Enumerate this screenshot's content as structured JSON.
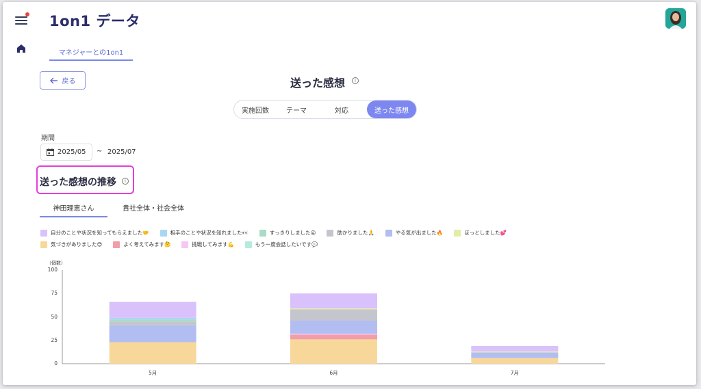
{
  "header": {
    "title": "1on1 データ",
    "tab": "マネジャーとの1on1"
  },
  "nav": {
    "back_label": "戻る",
    "page_title": "送った感想",
    "info_glyph": "i"
  },
  "segments": [
    {
      "label": "実施回数",
      "active": false
    },
    {
      "label": "テーマ",
      "active": false
    },
    {
      "label": "対応",
      "active": false
    },
    {
      "label": "送った感想",
      "active": true
    }
  ],
  "period": {
    "label": "期間",
    "start": "2025/05",
    "tilde": "~",
    "end": "2025/07"
  },
  "section": {
    "title": "送った感想の推移",
    "tabs": [
      {
        "label": "神田理恵さん",
        "active": true
      },
      {
        "label": "貴社全体・社会全体",
        "active": false
      }
    ]
  },
  "legend": [
    {
      "label": "自分のことや状況を知ってもらえました🤝",
      "color": "#d9c2fb"
    },
    {
      "label": "相手のことや状況を知れました👀",
      "color": "#aad6f0"
    },
    {
      "label": "すっきりしました😜",
      "color": "#a8dcc7"
    },
    {
      "label": "助かりました🙏",
      "color": "#c5c6cd"
    },
    {
      "label": "やる気が出ました🔥",
      "color": "#b2bdf1"
    },
    {
      "label": "ほっとしました💕",
      "color": "#e2eda5"
    },
    {
      "label": "気づきがありました😍",
      "color": "#f8d89a"
    },
    {
      "label": "よく考えてみます🤔",
      "color": "#f29ea8"
    },
    {
      "label": "挑戦してみます💪",
      "color": "#f7c6f5"
    },
    {
      "label": "もう一度会話したいです💬",
      "color": "#b5ebdd"
    }
  ],
  "chart_data": {
    "type": "bar",
    "stacked": true,
    "ylabel": "（個数）",
    "ylim": [
      0,
      100
    ],
    "yticks": [
      0,
      25,
      50,
      75,
      100
    ],
    "categories": [
      "5月",
      "6月",
      "7月"
    ],
    "series": [
      {
        "name": "気づきがありました😍",
        "color": "#f8d89a",
        "values": [
          23,
          26,
          6
        ]
      },
      {
        "name": "よく考えてみます🤔",
        "color": "#f29ea8",
        "values": [
          0,
          5,
          0
        ]
      },
      {
        "name": "挑戦してみます💪",
        "color": "#f7c6f5",
        "values": [
          0,
          1,
          0
        ]
      },
      {
        "name": "やる気が出ました🔥",
        "color": "#b2bdf1",
        "values": [
          18,
          14,
          6
        ]
      },
      {
        "name": "助かりました🙏",
        "color": "#c5c6cd",
        "values": [
          4,
          12,
          0
        ]
      },
      {
        "name": "すっきりしました😜",
        "color": "#a8dcc7",
        "values": [
          2,
          0,
          0
        ]
      },
      {
        "name": "ほっとしました💕",
        "color": "#e2eda5",
        "values": [
          0,
          1,
          1
        ]
      },
      {
        "name": "相手のことや状況を知れました👀",
        "color": "#aad6f0",
        "values": [
          2,
          0,
          0
        ]
      },
      {
        "name": "自分のことや状況を知ってもらえました🤝",
        "color": "#d9c2fb",
        "values": [
          17,
          16,
          6
        ]
      }
    ]
  }
}
